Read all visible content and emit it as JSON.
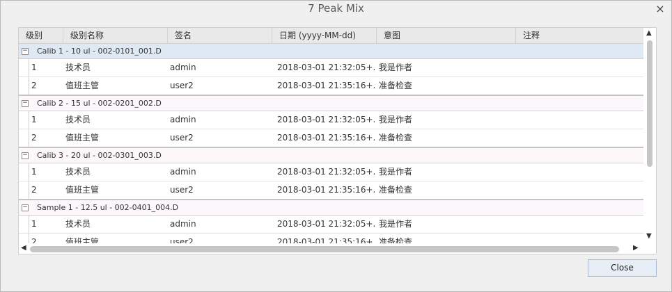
{
  "window": {
    "title": "7 Peak Mix"
  },
  "grid": {
    "columns": [
      "级别",
      "级别名称",
      "签名",
      "日期 (yyyy-MM-dd)",
      "意图",
      "注释"
    ],
    "groups": [
      {
        "label": "Calib 1 - 10 ul - 002-0101_001.D",
        "toggle": "−",
        "selected": true,
        "rows": [
          {
            "level": "1",
            "level_name": "技术员",
            "signature": "admin",
            "date": "2018-03-01 21:32:05+...",
            "intent": "我是作者",
            "note": ""
          },
          {
            "level": "2",
            "level_name": "值班主管",
            "signature": "user2",
            "date": "2018-03-01 21:35:16+...",
            "intent": "准备检查",
            "note": ""
          }
        ]
      },
      {
        "label": "Calib 2 - 15 ul - 002-0201_002.D",
        "toggle": "−",
        "selected": false,
        "rows": [
          {
            "level": "1",
            "level_name": "技术员",
            "signature": "admin",
            "date": "2018-03-01 21:32:05+...",
            "intent": "我是作者",
            "note": ""
          },
          {
            "level": "2",
            "level_name": "值班主管",
            "signature": "user2",
            "date": "2018-03-01 21:35:16+...",
            "intent": "准备检查",
            "note": ""
          }
        ]
      },
      {
        "label": "Calib 3 - 20 ul - 002-0301_003.D",
        "toggle": "−",
        "selected": false,
        "rows": [
          {
            "level": "1",
            "level_name": "技术员",
            "signature": "admin",
            "date": "2018-03-01 21:32:05+...",
            "intent": "我是作者",
            "note": ""
          },
          {
            "level": "2",
            "level_name": "值班主管",
            "signature": "user2",
            "date": "2018-03-01 21:35:16+...",
            "intent": "准备检查",
            "note": ""
          }
        ]
      },
      {
        "label": "Sample 1 - 12.5 ul - 002-0401_004.D",
        "toggle": "−",
        "selected": false,
        "rows": [
          {
            "level": "1",
            "level_name": "技术员",
            "signature": "admin",
            "date": "2018-03-01 21:32:05+...",
            "intent": "我是作者",
            "note": ""
          },
          {
            "level": "2",
            "level_name": "值班主管",
            "signature": "user2",
            "date": "2018-03-01 21:35:16+...",
            "intent": "准备检查",
            "note": ""
          }
        ]
      }
    ],
    "icons": {
      "close": "×",
      "scroll_up": "▲",
      "scroll_down": "▼",
      "scroll_left": "◀",
      "scroll_right": "▶"
    }
  },
  "footer": {
    "close_label": "Close"
  },
  "colors": {
    "selected_group": "#dfe9f4",
    "header_bg": "#e9e9e9"
  }
}
